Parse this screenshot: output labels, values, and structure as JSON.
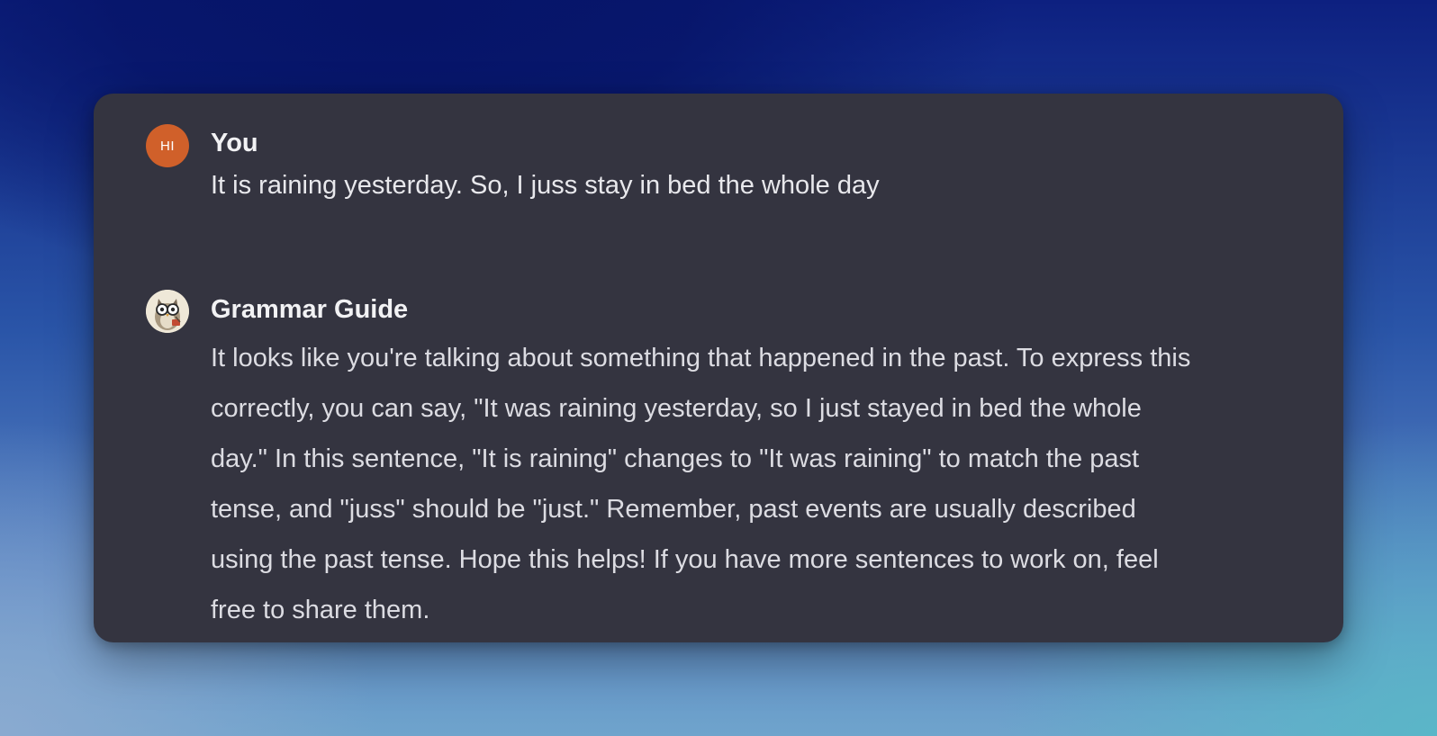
{
  "conversation": {
    "user": {
      "avatar_initials": "HI",
      "avatar_color": "#d0602a",
      "name": "You",
      "message": "It is raining yesterday. So, I juss stay in bed the whole day"
    },
    "assistant": {
      "avatar_icon": "owl-teacher-icon",
      "name": "Grammar Guide",
      "message": "It looks like you're talking about something that happened in the past. To express this correctly, you can say, \"It was raining yesterday, so I just stayed in bed the whole day.\" In this sentence, \"It is raining\" changes to \"It was raining\" to match the past tense, and \"juss\" should be \"just.\" Remember, past events are usually described using the past tense. Hope this helps! If you have more sentences to work on, feel free to share them."
    }
  },
  "colors": {
    "card_background": "#343440",
    "text_primary": "#f2f2f4",
    "text_body": "#dcdce2"
  }
}
